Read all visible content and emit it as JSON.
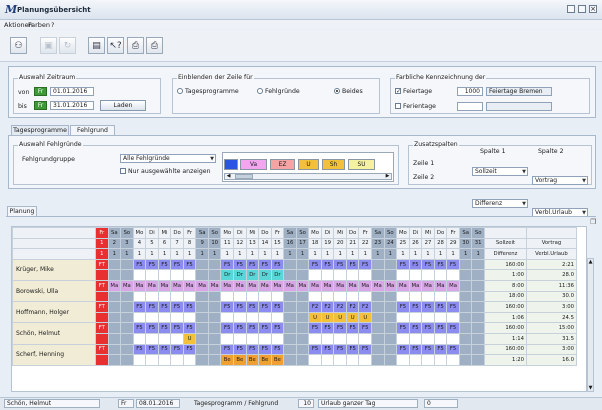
{
  "window": {
    "logo": "M",
    "title": "Planungsübersicht"
  },
  "menu": [
    "Aktionen",
    "Farben",
    "?"
  ],
  "toolbar": {
    "icons": [
      "users-icon",
      "save-icon",
      "refresh-icon",
      "page-icon",
      "help-cursor-icon",
      "print-icon",
      "print-preview-icon"
    ]
  },
  "zeitraum": {
    "title": "Auswahl Zeitraum",
    "von_label": "von",
    "von_day": "Fr",
    "von_date": "01.01.2016",
    "bis_label": "bis",
    "bis_day": "Fr",
    "bis_date": "31.01.2016",
    "load_button": "Laden"
  },
  "einblenden": {
    "title": "Einblenden der Zeile für",
    "options": [
      "Tagesprogramme",
      "Fehlgründe",
      "Beides"
    ],
    "selected": "Beides"
  },
  "farbliche": {
    "title": "Farbliche Kennzeichnung der",
    "feiertage_label": "Feiertage",
    "feiertage_checked": true,
    "feiertage_number": "1000",
    "feiertage_name": "Feiertage Bremen",
    "ferientage_label": "Ferientage",
    "ferientage_checked": false
  },
  "tabs_top": [
    "Tagesprogramme",
    "Fehlgrund"
  ],
  "fehlgrund": {
    "title": "Auswahl Fehlgründe",
    "gruppe_label": "Fehlgrundgruppe",
    "gruppe_value": "Alle Fehlgründe",
    "nur_label": "Nur ausgewählte anzeigen",
    "swatches": [
      {
        "label": "",
        "color": "#2b55e0"
      },
      {
        "label": "Va",
        "color": "#f3a6f0"
      },
      {
        "label": "EZ",
        "color": "#f5a3a3"
      },
      {
        "label": "U",
        "color": "#f2c03a"
      },
      {
        "label": "Sh",
        "color": "#f2c03a"
      },
      {
        "label": "SU",
        "color": "#f4f2a0"
      }
    ]
  },
  "zusatz": {
    "title": "Zusatzspalten",
    "spalte1": "Spalte 1",
    "spalte2": "Spalte 2",
    "zeile1": "Zeile 1",
    "zeile2": "Zeile 2",
    "z1s1": "Sollzeit",
    "z1s2": "Vortrag",
    "z2s1": "Differenz",
    "z2s2": "Verbl.Urlaub"
  },
  "planning_tab": "Planung",
  "grid": {
    "dows": [
      "Fr",
      "Sa",
      "So",
      "Mo",
      "Di",
      "Mi",
      "Do",
      "Fr",
      "Sa",
      "So",
      "Mo",
      "Di",
      "Mi",
      "Do",
      "Fr",
      "Sa",
      "So",
      "Mo",
      "Di",
      "Mi",
      "Do",
      "Fr",
      "Sa",
      "So",
      "Mo",
      "Di",
      "Mi",
      "Do",
      "Fr",
      "Sa",
      "So"
    ],
    "days": [
      "1",
      "2",
      "3",
      "4",
      "5",
      "6",
      "7",
      "8",
      "9",
      "10",
      "11",
      "12",
      "13",
      "14",
      "15",
      "16",
      "17",
      "18",
      "19",
      "20",
      "21",
      "22",
      "23",
      "24",
      "25",
      "26",
      "27",
      "28",
      "29",
      "30",
      "31"
    ],
    "ones": [
      "1",
      "1",
      "1",
      "1",
      "1",
      "1",
      "1",
      "1",
      "1",
      "1",
      "1",
      "1",
      "1",
      "1",
      "1",
      "1",
      "1",
      "1",
      "1",
      "1",
      "1",
      "1",
      "1",
      "1",
      "1",
      "1",
      "1",
      "1",
      "1",
      "1",
      "1"
    ],
    "extra_head1": [
      "Sollzeit",
      "Vortrag"
    ],
    "extra_head2": [
      "Differenz",
      "Verbl.Urlaub"
    ],
    "employees": [
      {
        "name": "Krüger, Mike",
        "r1": [
          "FT",
          "",
          "",
          "F5",
          "F5",
          "F5",
          "F5",
          "F5",
          "",
          "",
          "F5",
          "F5",
          "F5",
          "F5",
          "F5",
          "",
          "",
          "F5",
          "F5",
          "F5",
          "F5",
          "F5",
          "",
          "",
          "F5",
          "F5",
          "F5",
          "F5",
          "F5",
          "",
          ""
        ],
        "r2": [
          "",
          "",
          "",
          "",
          "",
          "",
          "",
          "",
          "",
          "",
          "Dr",
          "Dr",
          "Dr",
          "Dr",
          "Dr",
          "",
          "",
          "",
          "",
          "",
          "",
          "",
          "",
          "",
          "",
          "",
          "",
          "",
          "",
          "",
          ""
        ],
        "e1": [
          "160:00",
          "2:21"
        ],
        "e2": [
          "1:00",
          "28.0"
        ]
      },
      {
        "name": "Borowski, Ulla",
        "r1": [
          "FT",
          "Ma",
          "Ma",
          "Ma",
          "Ma",
          "Ma",
          "Ma",
          "Ma",
          "Ma",
          "Ma",
          "Ma",
          "Ma",
          "Ma",
          "Ma",
          "Ma",
          "Ma",
          "Ma",
          "Ma",
          "Ma",
          "Ma",
          "Ma",
          "Ma",
          "Ma",
          "Ma",
          "Ma",
          "Ma",
          "Ma",
          "Ma",
          "Ma",
          "",
          ""
        ],
        "r2": [
          "",
          "",
          "",
          "",
          "",
          "",
          "",
          "",
          "",
          "",
          "",
          "",
          "",
          "",
          "",
          "",
          "",
          "",
          "",
          "",
          "",
          "",
          "",
          "",
          "",
          "",
          "",
          "",
          "",
          "",
          ""
        ],
        "e1": [
          "8:00",
          "11:36"
        ],
        "e2": [
          "18:00",
          "30.0"
        ]
      },
      {
        "name": "Hoffmann, Holger",
        "r1": [
          "FT",
          "",
          "",
          "F5",
          "F5",
          "F5",
          "F5",
          "F5",
          "",
          "",
          "F5",
          "F5",
          "F5",
          "F5",
          "F5",
          "",
          "",
          "F2",
          "F2",
          "F2",
          "F2",
          "F2",
          "",
          "",
          "F5",
          "F5",
          "F5",
          "F5",
          "F5",
          "",
          ""
        ],
        "r2": [
          "",
          "",
          "",
          "",
          "",
          "",
          "",
          "",
          "",
          "",
          "",
          "",
          "",
          "",
          "",
          "",
          "",
          "U",
          "U",
          "U",
          "U",
          "U",
          "",
          "",
          "",
          "",
          "",
          "",
          "",
          "",
          ""
        ],
        "e1": [
          "160:00",
          "3:00"
        ],
        "e2": [
          "1:06",
          "24.5"
        ]
      },
      {
        "name": "Schön, Helmut",
        "r1": [
          "FT",
          "",
          "",
          "F5",
          "F5",
          "F5",
          "F5",
          "F5",
          "",
          "",
          "F5",
          "F5",
          "F5",
          "F5",
          "F5",
          "",
          "",
          "F5",
          "F5",
          "F5",
          "F5",
          "F5",
          "",
          "",
          "F5",
          "F5",
          "F5",
          "F5",
          "F5",
          "",
          ""
        ],
        "r2": [
          "",
          "",
          "",
          "",
          "",
          "",
          "",
          "U",
          "",
          "",
          "",
          "",
          "",
          "",
          "",
          "",
          "",
          "",
          "",
          "",
          "",
          "",
          "",
          "",
          "",
          "",
          "",
          "",
          "",
          "",
          ""
        ],
        "e1": [
          "160:00",
          "15:00"
        ],
        "e2": [
          "1:14",
          "31.5"
        ]
      },
      {
        "name": "Scherf, Henning",
        "r1": [
          "FT",
          "",
          "",
          "F5",
          "F5",
          "F5",
          "F5",
          "F5",
          "",
          "",
          "F5",
          "F5",
          "F5",
          "F5",
          "F5",
          "",
          "",
          "F5",
          "F5",
          "F5",
          "F5",
          "F5",
          "",
          "",
          "F5",
          "F5",
          "F5",
          "F5",
          "F5",
          "",
          ""
        ],
        "r2": [
          "",
          "",
          "",
          "",
          "",
          "",
          "",
          "",
          "",
          "",
          "Be",
          "Be",
          "Be",
          "Be",
          "Be",
          "",
          "",
          "",
          "",
          "",
          "",
          "",
          "",
          "",
          "",
          "",
          "",
          "",
          "",
          "",
          ""
        ],
        "e1": [
          "160:00",
          "3:00"
        ],
        "e2": [
          "1:20",
          "16.0"
        ]
      }
    ]
  },
  "status": {
    "name": "Schön, Helmut",
    "day": "Fr",
    "date": "08.01.2016",
    "caption": "Tagesprogramm / Fehlgrund",
    "code": "10",
    "desc": "Urlaub ganzer Tag",
    "value": "0"
  },
  "colors": {
    "F5": "#8c8cf0",
    "F2": "#8c8cf0",
    "Ma": "#d8a6e6",
    "Dr": "#58d6d8",
    "U": "#f2c03a",
    "Be": "#f0a030",
    "weekend": "#9fb0c4",
    "holiday": "#e83030",
    "name_bg": "#f1ecd6"
  }
}
